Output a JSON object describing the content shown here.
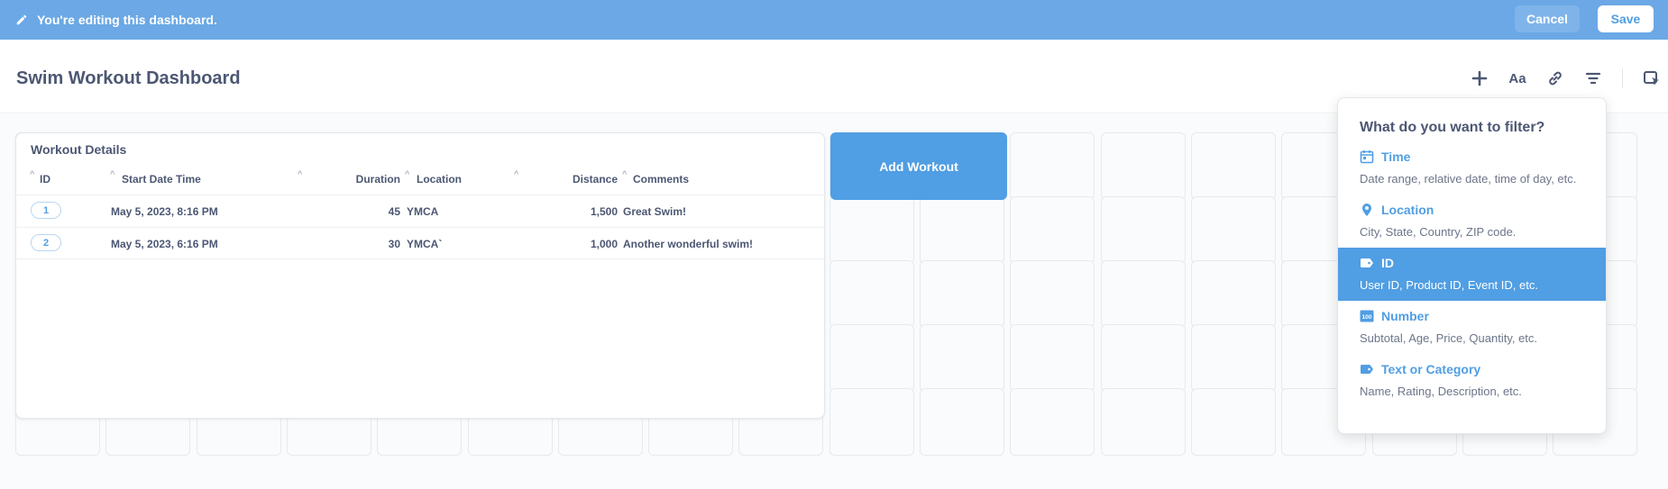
{
  "edit_bar": {
    "message": "You're editing this dashboard.",
    "cancel_label": "Cancel",
    "save_label": "Save"
  },
  "header": {
    "title": "Swim Workout Dashboard",
    "tools": [
      "add-icon",
      "text-icon",
      "link-icon",
      "filter-icon",
      "click-behavior-icon"
    ],
    "text_tool_label": "Aa"
  },
  "table_card": {
    "title": "Workout Details",
    "columns": [
      "ID",
      "Start Date Time",
      "Duration",
      "Location",
      "Distance",
      "Comments"
    ],
    "rows": [
      {
        "id": "1",
        "start": "May 5, 2023, 8:16 PM",
        "duration": "45",
        "location": "YMCA",
        "distance": "1,500",
        "comments": "Great Swim!"
      },
      {
        "id": "2",
        "start": "May 5, 2023, 6:16 PM",
        "duration": "30",
        "location": "YMCA`",
        "distance": "1,000",
        "comments": "Another wonderful swim!"
      }
    ]
  },
  "action_card": {
    "label": "Add Workout"
  },
  "filter_popover": {
    "title": "What do you want to filter?",
    "options": [
      {
        "icon": "calendar-icon",
        "label": "Time",
        "description": "Date range, relative date, time of day, etc."
      },
      {
        "icon": "location-pin-icon",
        "label": "Location",
        "description": "City, State, Country, ZIP code."
      },
      {
        "icon": "label-icon",
        "label": "ID",
        "description": "User ID, Product ID, Event ID, etc."
      },
      {
        "icon": "number-icon",
        "label": "Number",
        "description": "Subtotal, Age, Price, Quantity, etc."
      },
      {
        "icon": "label-icon",
        "label": "Text or Category",
        "description": "Name, Rating, Description, etc."
      }
    ],
    "number_icon_text": "100"
  },
  "colors": {
    "edit_bar": "#6ba8e5",
    "brand": "#509ee3",
    "text": "#4c5773"
  }
}
